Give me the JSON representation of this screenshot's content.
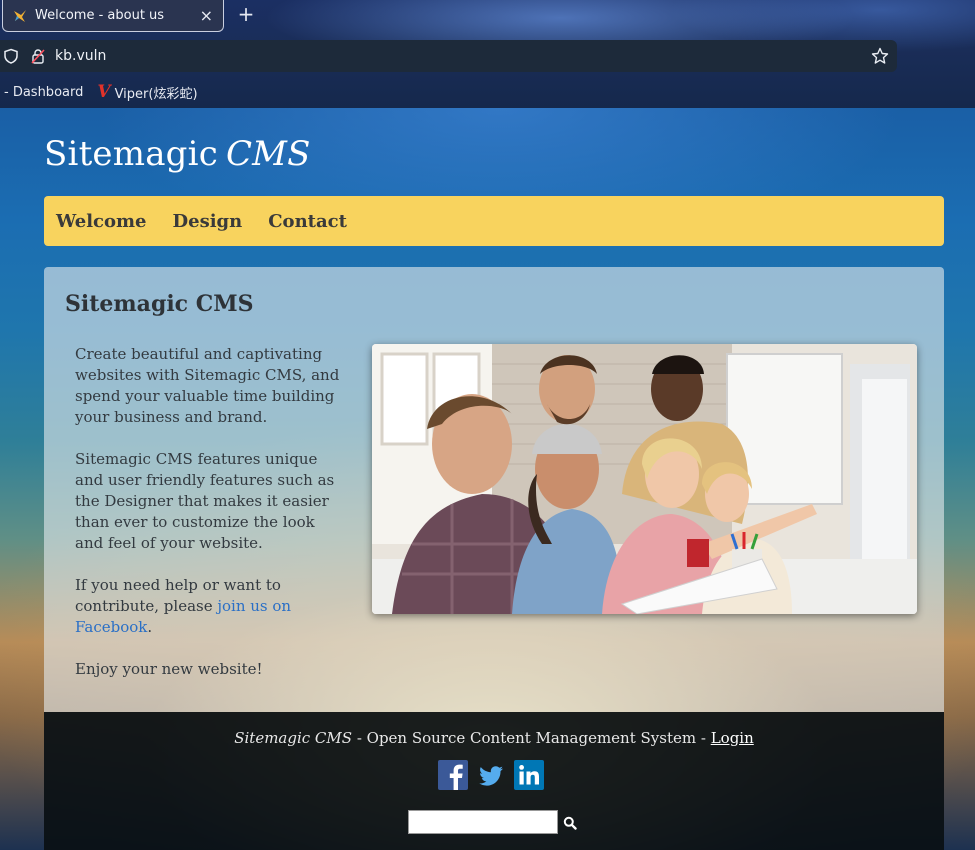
{
  "browser": {
    "tab_title": "Welcome - about us",
    "tab_close": "×",
    "new_tab": "+",
    "url": "kb.vuln",
    "bookmarks": [
      {
        "label": "- Dashboard"
      },
      {
        "label": "Viper(炫彩蛇)",
        "icon_letter": "V"
      }
    ]
  },
  "site": {
    "title_main": "Sitemagic",
    "title_italic": "CMS",
    "nav": [
      "Welcome",
      "Design",
      "Contact"
    ]
  },
  "content": {
    "heading": "Sitemagic CMS",
    "paragraph_1": "Create beautiful and captivating websites with Sitemagic CMS, and spend your valuable time building your business and brand.",
    "paragraph_2": "Sitemagic CMS features unique and user friendly features such as the Designer that makes it easier than ever to customize the look and feel of your website.",
    "paragraph_3_prefix": "If you need help or want to contribute, please ",
    "paragraph_3_link": "join us on Facebook",
    "paragraph_3_suffix": ".",
    "paragraph_4": "Enjoy your new website!",
    "image": "photo of a group of young people looking at a computer screen"
  },
  "footer": {
    "brand": "Sitemagic CMS",
    "tagline": " - Open Source Content Management System - ",
    "login": "Login",
    "social": [
      "facebook-icon",
      "twitter-icon",
      "linkedin-icon"
    ],
    "search_value": ""
  },
  "colors": {
    "nav_bg": "#f8d35e",
    "link": "#2a6fc6",
    "footer_bg": "#0a1014",
    "facebook": "#3b5998",
    "twitter": "#55acee",
    "linkedin": "#0077b5"
  }
}
